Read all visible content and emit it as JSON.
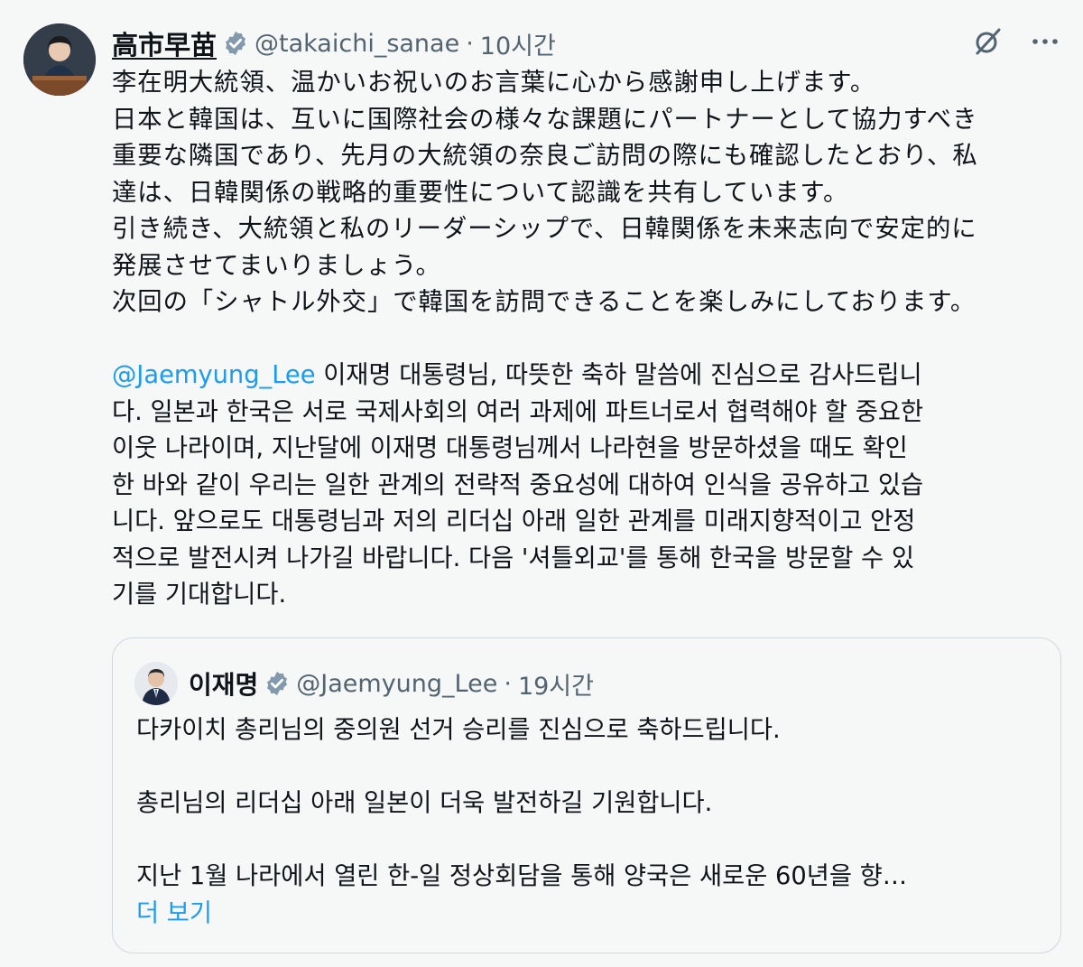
{
  "tweet": {
    "author": {
      "display_name": "高市早苗",
      "handle": "@takaichi_sanae",
      "time": "10시간"
    },
    "body_jp": [
      "李在明大統領、温かいお祝いのお言葉に心から感謝申し上げます。",
      "日本と韓国は、互いに国際社会の様々な課題にパートナーとして協力すべき",
      "重要な隣国であり、先月の大統領の奈良ご訪問の際にも確認したとおり、私",
      "達は、日韓関係の戦略的重要性について認識を共有しています。",
      "引き続き、大統領と私のリーダーシップで、日韓関係を未来志向で安定的に",
      "発展させてまいりましょう。",
      "次回の「シャトル外交」で韓国を訪問できることを楽しみにしております。"
    ],
    "body_kr": {
      "mention": "@Jaemyung_Lee",
      "first_line_rest": " 이재명 대통령님, 따뜻한 축하 말씀에 진심으로 감사드립니",
      "lines": [
        "다. 일본과 한국은 서로 국제사회의 여러 과제에 파트너로서 협력해야 할 중요한",
        "이웃 나라이며, 지난달에 이재명 대통령님께서 나라현을 방문하셨을 때도 확인",
        "한 바와 같이 우리는 일한 관계의 전략적 중요성에 대하여 인식을 공유하고 있습",
        "니다. 앞으로도 대통령님과 저의 리더십 아래 일한 관계를 미래지향적이고 안정",
        "적으로 발전시켜 나가길 바랍니다. 다음 '셔틀외교'를 통해 한국을 방문할 수 있",
        "기를 기대합니다."
      ]
    },
    "quote": {
      "display_name": "이재명",
      "handle": "@Jaemyung_Lee",
      "time": "19시간",
      "line1": "다카이치 총리님의 중의원 선거 승리를 진심으로 축하드립니다.",
      "line2": "총리님의 리더십 아래 일본이 더욱 발전하길 기원합니다.",
      "line3": "지난 1월 나라에서 열린 한-일 정상회담을 통해 양국은 새로운 60년을 향…",
      "more": "더 보기"
    },
    "separator": "·"
  },
  "colors": {
    "background": "#f6f7f7",
    "text": "#0f1419",
    "secondary": "#536471",
    "link": "#1d9bf0",
    "verified": "#829aab",
    "border": "#cfd9de"
  },
  "icons": {
    "verified": "verified-badge-icon",
    "grok": "grok-icon",
    "more": "more-icon"
  }
}
